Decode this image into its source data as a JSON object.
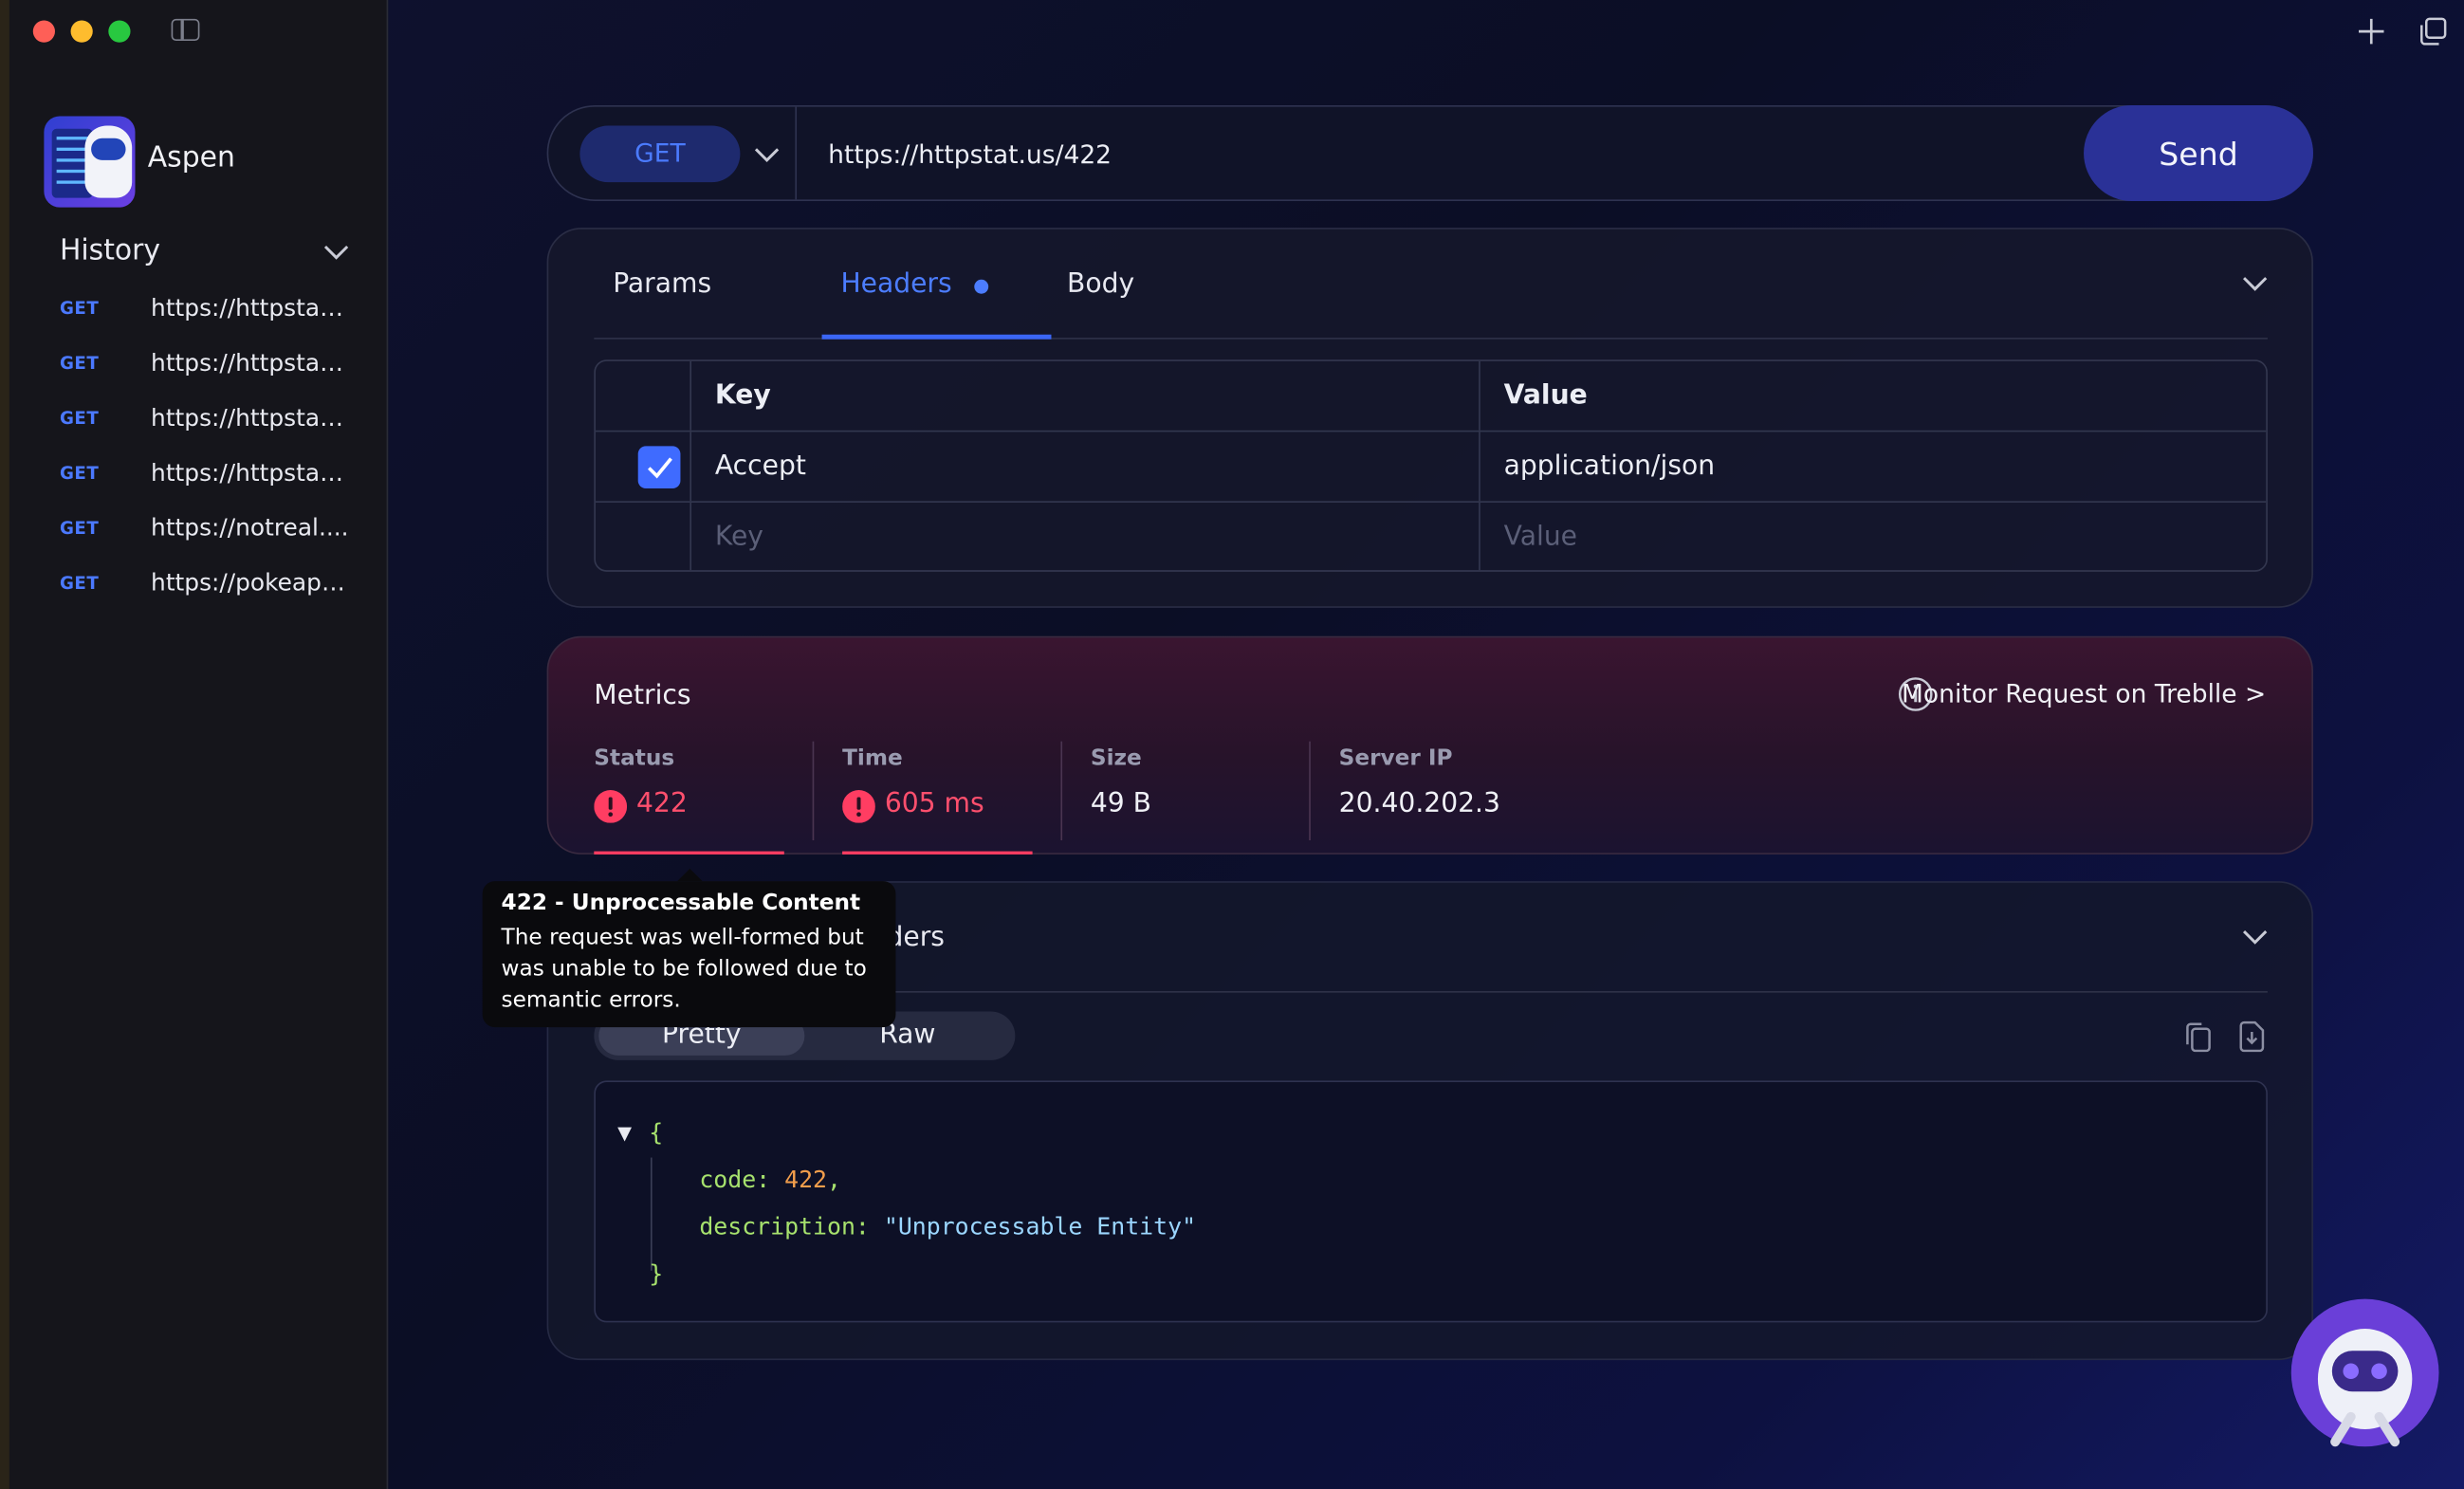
{
  "app": {
    "name": "Aspen"
  },
  "sidebar": {
    "history_title": "History",
    "history": [
      {
        "method": "GET",
        "url": "https://httpstat..."
      },
      {
        "method": "GET",
        "url": "https://httpstat..."
      },
      {
        "method": "GET",
        "url": "https://httpstat..."
      },
      {
        "method": "GET",
        "url": "https://httpstat..."
      },
      {
        "method": "GET",
        "url": "https://notreal...."
      },
      {
        "method": "GET",
        "url": "https://pokeapi..."
      }
    ]
  },
  "request": {
    "method": "GET",
    "url": "https://httpstat.us/422",
    "send_label": "Send",
    "tabs": [
      "Params",
      "Headers",
      "Body"
    ],
    "active_tab": "Headers",
    "headers_table": {
      "columns": [
        "Key",
        "Value"
      ],
      "rows": [
        {
          "enabled": true,
          "key": "Accept",
          "value": "application/json"
        }
      ],
      "key_placeholder": "Key",
      "value_placeholder": "Value"
    }
  },
  "metrics": {
    "title": "Metrics",
    "monitor_link": "Monitor Request on Treblle >",
    "items": [
      {
        "label": "Status",
        "value": "422",
        "error": true
      },
      {
        "label": "Time",
        "value": "605 ms",
        "error": true
      },
      {
        "label": "Size",
        "value": "49 B",
        "error": false
      },
      {
        "label": "Server IP",
        "value": "20.40.202.3",
        "error": false
      }
    ]
  },
  "response": {
    "tab_label_partial": "ders",
    "view_modes": [
      "Pretty",
      "Raw"
    ],
    "active_view": "Pretty",
    "code": {
      "open": "{",
      "line1_key": "code:",
      "line1_value": "422",
      "line1_comma": ",",
      "line2_key": "description:",
      "line2_value": "\"Unprocessable Entity\"",
      "close": "}"
    }
  },
  "tooltip": {
    "title": "422 - Unprocessable Content",
    "body": "The request was well-formed but was unable to be followed due to semantic errors."
  },
  "colors": {
    "accent": "#3b66f5",
    "error": "#ff4f6d",
    "send": "#2a3197"
  }
}
